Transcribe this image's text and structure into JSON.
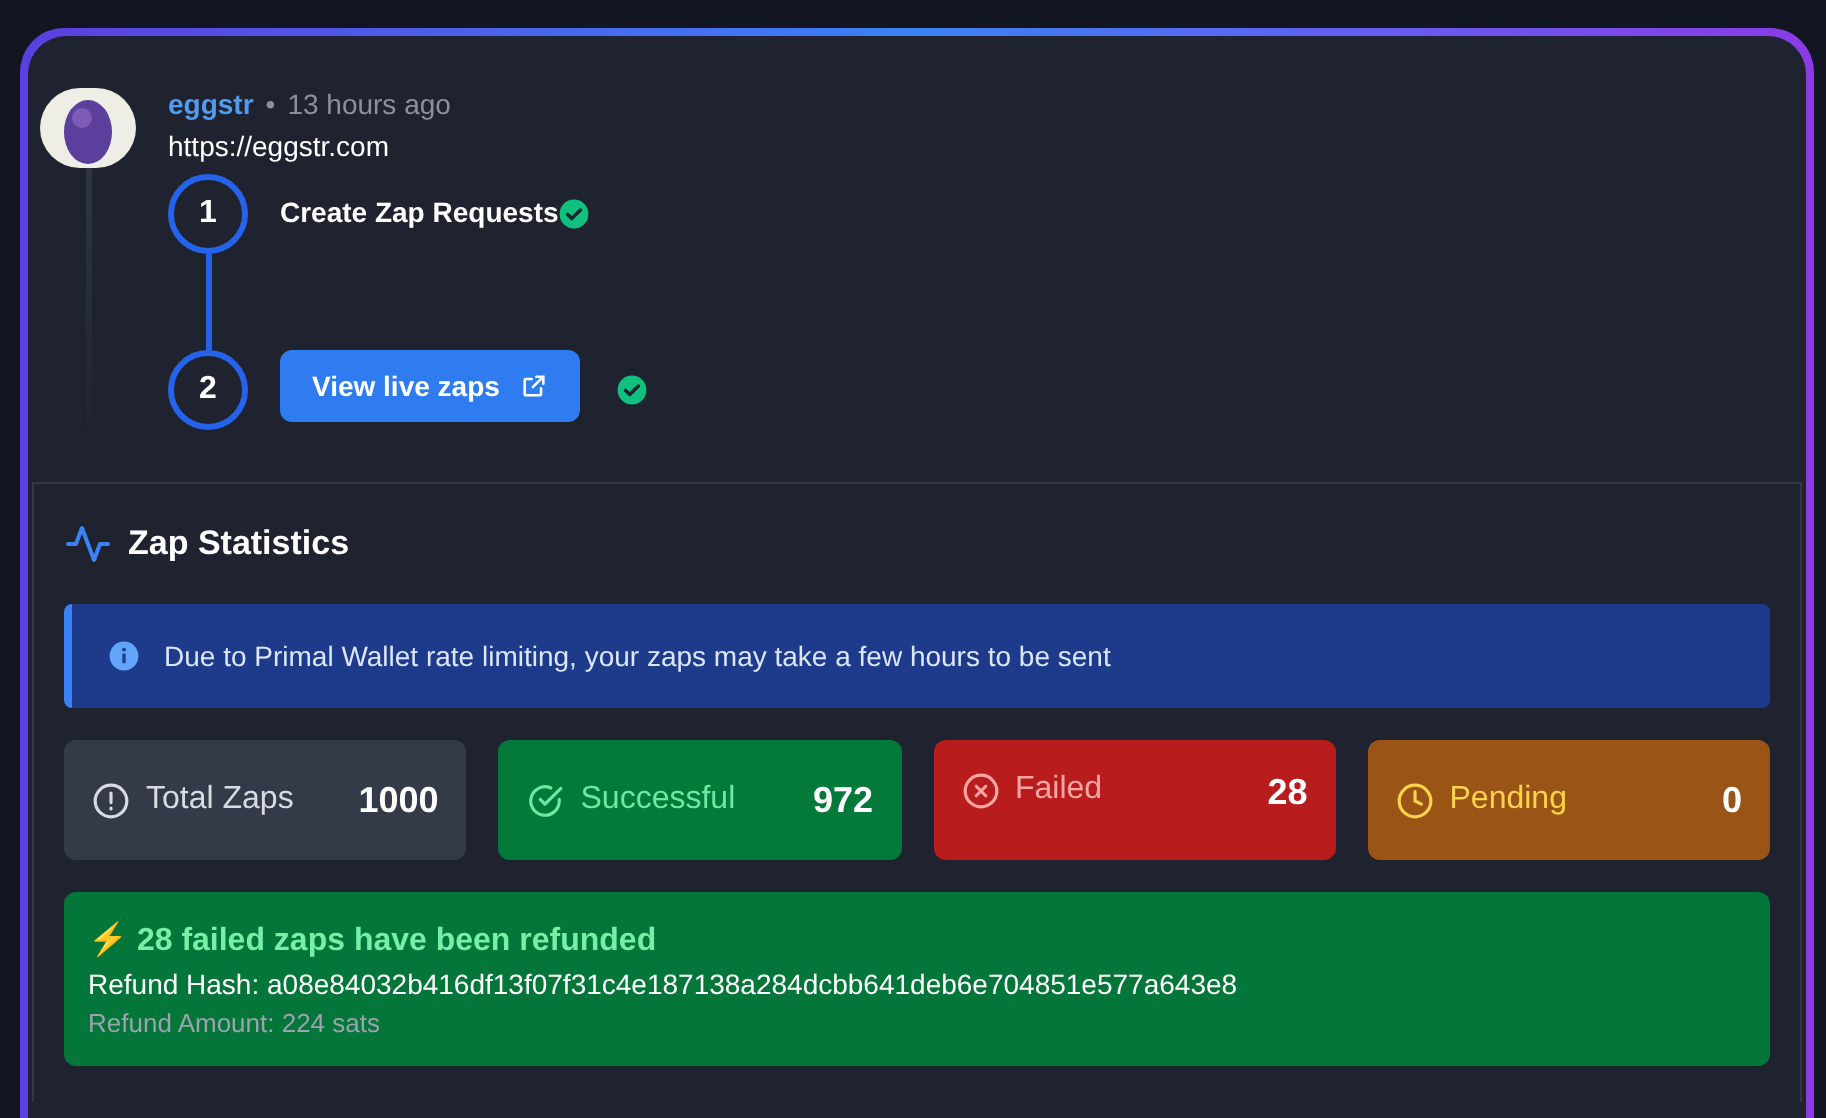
{
  "post": {
    "author": "eggstr",
    "separator": "•",
    "time": "13 hours ago",
    "content": "https://eggstr.com"
  },
  "steps": [
    {
      "number": "1",
      "kind": "text",
      "label": "Create Zap Requests",
      "done": true
    },
    {
      "number": "2",
      "kind": "button",
      "label": "View live zaps",
      "done": true
    }
  ],
  "stats": {
    "title": "Zap Statistics",
    "notice": "Due to Primal Wallet rate limiting, your zaps may take a few hours to be sent",
    "cards": [
      {
        "kind": "total",
        "label": "Total Zaps",
        "value": "1000"
      },
      {
        "kind": "success",
        "label": "Successful",
        "value": "972"
      },
      {
        "kind": "failed",
        "label": "Failed",
        "value": "28"
      },
      {
        "kind": "pending",
        "label": "Pending",
        "value": "0"
      }
    ],
    "refund": {
      "title": "⚡ 28 failed zaps have been refunded",
      "hash": "Refund Hash: a08e84032b416df13f07f31c4e187138a284dcbb641deb6e704851e577a643e8",
      "amount": "Refund Amount: 224 sats"
    }
  }
}
